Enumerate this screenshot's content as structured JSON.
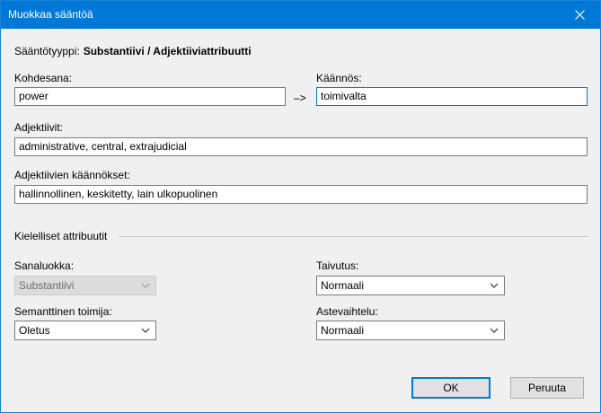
{
  "window": {
    "title": "Muokkaa sääntöä"
  },
  "rule_type": {
    "label": "Sääntötyyppi:",
    "value": "Substantiivi / Adjektiiviattribuutti"
  },
  "target_word": {
    "label": "Kohdesana:",
    "value": "power"
  },
  "arrow": "–>",
  "translation": {
    "label": "Käännös:",
    "value": "toimivalta"
  },
  "adjectives": {
    "label": "Adjektiivit:",
    "value": "administrative, central, extrajudicial"
  },
  "adjective_translations": {
    "label": "Adjektiivien käännökset:",
    "value": "hallinnollinen, keskitetty, lain ulkopuolinen"
  },
  "linguistic_section": {
    "label": "Kielelliset attribuutit"
  },
  "word_class": {
    "label": "Sanaluokka:",
    "value": "Substantiivi"
  },
  "inflection": {
    "label": "Taivutus:",
    "value": "Normaali"
  },
  "semantic_agent": {
    "label": "Semanttinen toimija:",
    "value": "Oletus"
  },
  "gradation": {
    "label": "Astevaihtelu:",
    "value": "Normaali"
  },
  "buttons": {
    "ok": "OK",
    "cancel": "Peruuta"
  },
  "colors": {
    "titlebar": "#0078d7",
    "focus_border": "#0078d7",
    "dialog_bg": "#f0f0f0"
  }
}
